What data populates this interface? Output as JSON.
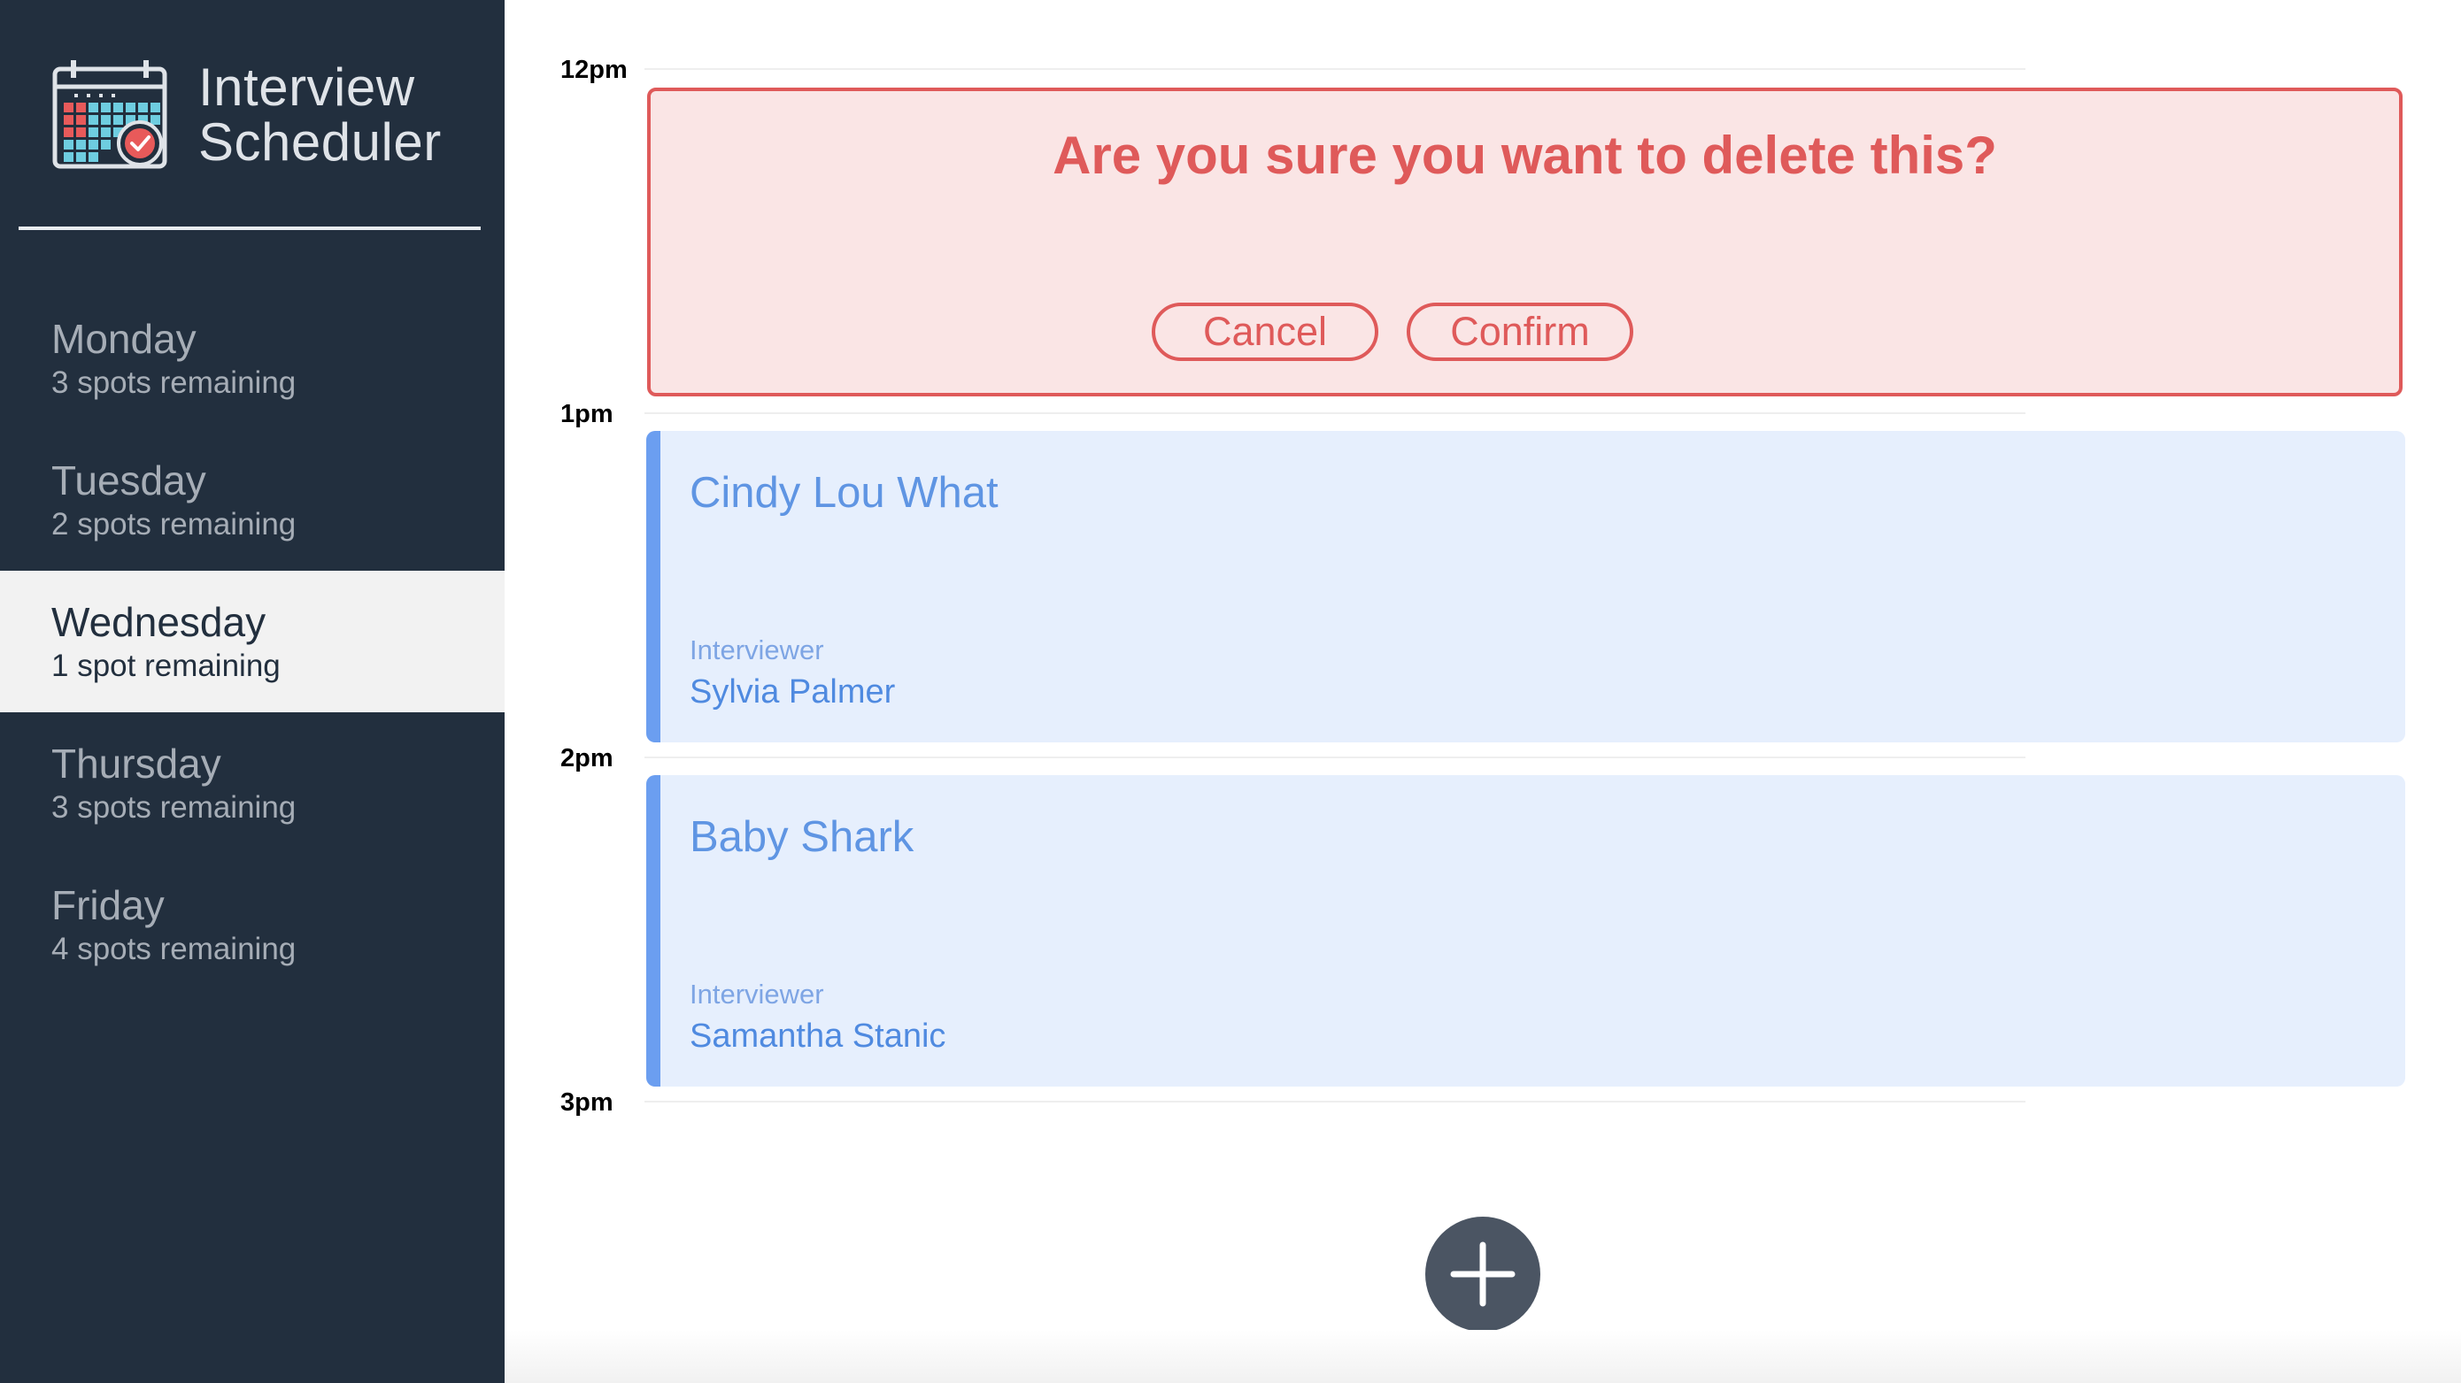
{
  "app": {
    "title_line1": "Interview",
    "title_line2": "Scheduler",
    "logo_icon": "calendar-check-icon"
  },
  "sidebar": {
    "days": [
      {
        "name": "Monday",
        "spots": "3 spots remaining",
        "selected": false
      },
      {
        "name": "Tuesday",
        "spots": "2 spots remaining",
        "selected": false
      },
      {
        "name": "Wednesday",
        "spots": "1 spot remaining",
        "selected": true
      },
      {
        "name": "Thursday",
        "spots": "3 spots remaining",
        "selected": false
      },
      {
        "name": "Friday",
        "spots": "4 spots remaining",
        "selected": false
      }
    ]
  },
  "schedule": {
    "hours": [
      "12pm",
      "1pm",
      "2pm",
      "3pm"
    ],
    "confirm": {
      "message": "Are you sure you want to delete this?",
      "cancel_label": "Cancel",
      "confirm_label": "Confirm"
    },
    "appointments": [
      {
        "student": "Cindy Lou What",
        "interviewer_label": "Interviewer",
        "interviewer": "Sylvia Palmer"
      },
      {
        "student": "Baby Shark",
        "interviewer_label": "Interviewer",
        "interviewer": "Samantha Stanic"
      }
    ],
    "add_icon": "plus-icon"
  },
  "colors": {
    "sidebar_bg": "#222f3e",
    "selected_day_bg": "#f2f2f2",
    "danger": "#df5a5a",
    "danger_bg": "#fae5e5",
    "appointment_bg": "#e6effd",
    "appointment_accent": "#6b9ef0",
    "add_button": "#4b5563"
  }
}
